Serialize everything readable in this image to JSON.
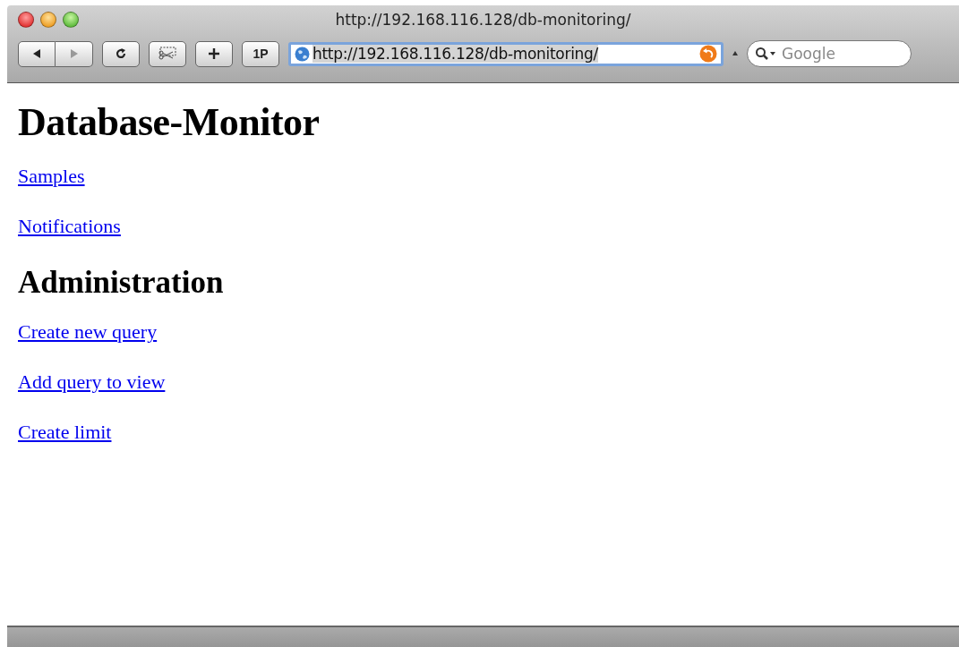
{
  "window": {
    "title": "http://192.168.116.128/db-monitoring/"
  },
  "toolbar": {
    "button_1p": "1P",
    "address": {
      "value": "http://192.168.116.128/db-monitoring/",
      "selected": true
    },
    "search": {
      "placeholder": "Google"
    }
  },
  "page": {
    "heading": "Database-Monitor",
    "links": [
      {
        "label": "Samples"
      },
      {
        "label": "Notifications"
      }
    ],
    "section": {
      "heading": "Administration",
      "links": [
        {
          "label": "Create new query"
        },
        {
          "label": "Add query to view"
        },
        {
          "label": "Create limit"
        }
      ]
    }
  }
}
